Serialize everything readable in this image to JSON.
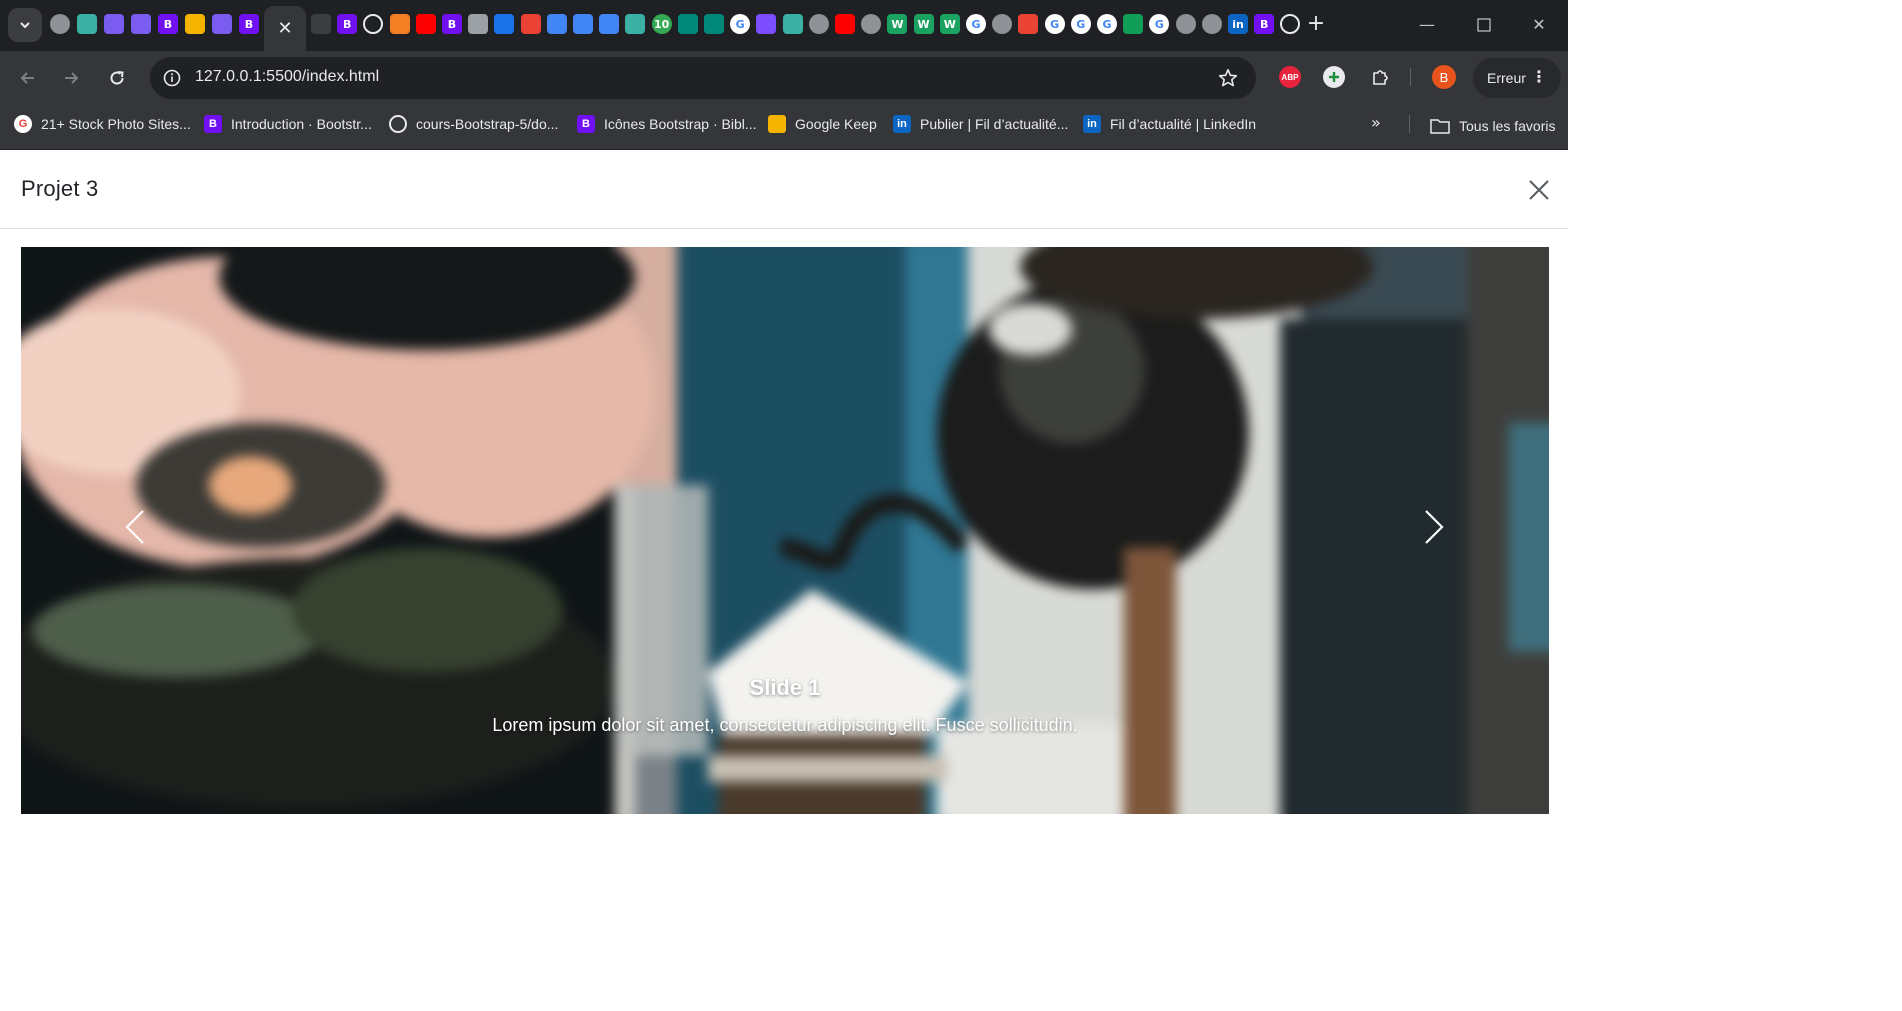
{
  "browser": {
    "address_bar": {
      "url": "127.0.0.1:5500/index.html"
    },
    "account_button": {
      "label": "Erreur"
    },
    "profile_initial": "B",
    "extensions": {
      "adblock_label": "ABP"
    },
    "tab_icons": [
      {
        "name": "tab-favicon-globe",
        "color": "#8e9196",
        "glyph": ""
      },
      {
        "name": "tab-favicon-stackblitz",
        "color": "#3bb1a5",
        "glyph": ""
      },
      {
        "name": "tab-favicon-arc",
        "color": "#7b5cf0",
        "glyph": ""
      },
      {
        "name": "tab-favicon-arc",
        "color": "#7b5cf0",
        "glyph": ""
      },
      {
        "name": "tab-favicon-bootstrap",
        "color": "#7110f2",
        "glyph": "B"
      },
      {
        "name": "tab-favicon-keep",
        "color": "#f5b400",
        "glyph": ""
      },
      {
        "name": "tab-favicon-arc",
        "color": "#7b5cf0",
        "glyph": ""
      },
      {
        "name": "tab-favicon-bootstrap",
        "color": "#7110f2",
        "glyph": "B"
      }
    ],
    "right_tab_icons": [
      {
        "name": "tab-favicon-generic",
        "color": "#3c3d41",
        "glyph": ""
      },
      {
        "name": "tab-favicon-bootstrap",
        "color": "#7110f2",
        "glyph": "B"
      },
      {
        "name": "tab-favicon-github",
        "color": "#e8eaed",
        "glyph": ""
      },
      {
        "name": "tab-favicon-stackoverflow",
        "color": "#f48024",
        "glyph": ""
      },
      {
        "name": "tab-favicon-youtube",
        "color": "#ff0000",
        "glyph": ""
      },
      {
        "name": "tab-favicon-bootstrap",
        "color": "#7110f2",
        "glyph": "B"
      },
      {
        "name": "tab-favicon-code",
        "color": "#9aa0a6",
        "glyph": ""
      },
      {
        "name": "tab-favicon-flag",
        "color": "#1a73e8",
        "glyph": ""
      },
      {
        "name": "tab-favicon-gmail",
        "color": "#ea4335",
        "glyph": ""
      },
      {
        "name": "tab-favicon-docs",
        "color": "#4285f4",
        "glyph": ""
      },
      {
        "name": "tab-favicon-docs",
        "color": "#4285f4",
        "glyph": ""
      },
      {
        "name": "tab-favicon-docs",
        "color": "#4285f4",
        "glyph": ""
      },
      {
        "name": "tab-favicon-stackblitz",
        "color": "#3bb1a5",
        "glyph": ""
      },
      {
        "name": "tab-favicon-badge",
        "color": "#34a853",
        "glyph": "10"
      },
      {
        "name": "tab-favicon-meet",
        "color": "#00897b",
        "glyph": ""
      },
      {
        "name": "tab-favicon-meet",
        "color": "#00897b",
        "glyph": ""
      },
      {
        "name": "tab-favicon-google",
        "color": "#ffffff",
        "glyph": "G"
      },
      {
        "name": "tab-favicon-hashtag",
        "color": "#7c4dff",
        "glyph": ""
      },
      {
        "name": "tab-favicon-stackblitz",
        "color": "#3bb1a5",
        "glyph": ""
      },
      {
        "name": "tab-favicon-globe",
        "color": "#8e9196",
        "glyph": ""
      },
      {
        "name": "tab-favicon-youtube",
        "color": "#ff0000",
        "glyph": ""
      },
      {
        "name": "tab-favicon-globe",
        "color": "#8e9196",
        "glyph": ""
      },
      {
        "name": "tab-favicon-w",
        "color": "#1aa260",
        "glyph": "W"
      },
      {
        "name": "tab-favicon-w",
        "color": "#1aa260",
        "glyph": "W"
      },
      {
        "name": "tab-favicon-w",
        "color": "#1aa260",
        "glyph": "W"
      },
      {
        "name": "tab-favicon-google",
        "color": "#ffffff",
        "glyph": "G"
      },
      {
        "name": "tab-favicon-globe",
        "color": "#8e9196",
        "glyph": ""
      },
      {
        "name": "tab-favicon-gmail",
        "color": "#ea4335",
        "glyph": ""
      },
      {
        "name": "tab-favicon-google",
        "color": "#ffffff",
        "glyph": "G"
      },
      {
        "name": "tab-favicon-google",
        "color": "#ffffff",
        "glyph": "G"
      },
      {
        "name": "tab-favicon-google",
        "color": "#ffffff",
        "glyph": "G"
      },
      {
        "name": "tab-favicon-classroom",
        "color": "#0f9d58",
        "glyph": ""
      },
      {
        "name": "tab-favicon-google",
        "color": "#ffffff",
        "glyph": "G"
      },
      {
        "name": "tab-favicon-globe",
        "color": "#8e9196",
        "glyph": ""
      },
      {
        "name": "tab-favicon-globe",
        "color": "#8e9196",
        "glyph": ""
      },
      {
        "name": "tab-favicon-linkedin",
        "color": "#0a66c2",
        "glyph": "in"
      },
      {
        "name": "tab-favicon-bootstrap",
        "color": "#7110f2",
        "glyph": "B"
      },
      {
        "name": "tab-favicon-github",
        "color": "#e8eaed",
        "glyph": ""
      }
    ],
    "bookmarks": [
      {
        "label": "21+ Stock Photo Sites...",
        "icon": "google-icon",
        "color": "#ffffff",
        "glyph": "G"
      },
      {
        "label": "Introduction · Bootstr...",
        "icon": "bootstrap-icon",
        "color": "#7110f2",
        "glyph": "B"
      },
      {
        "label": "cours-Bootstrap-5/do...",
        "icon": "github-icon",
        "color": "#e8eaed",
        "glyph": ""
      },
      {
        "label": "Icônes Bootstrap · Bibl...",
        "icon": "bootstrap-icon",
        "color": "#7110f2",
        "glyph": "B"
      },
      {
        "label": "Google Keep",
        "icon": "keep-icon",
        "color": "#f5b400",
        "glyph": ""
      },
      {
        "label": "Publier | Fil d’actualité...",
        "icon": "linkedin-icon",
        "color": "#0a66c2",
        "glyph": "in"
      },
      {
        "label": "Fil d’actualité | LinkedIn",
        "icon": "linkedin-icon",
        "color": "#0a66c2",
        "glyph": "in"
      }
    ],
    "all_bookmarks_label": "Tous les favoris"
  },
  "page": {
    "modal": {
      "title": "Projet 3",
      "carousel": {
        "slide_title": "Slide 1",
        "slide_text": "Lorem ipsum dolor sit amet, consectetur adipiscing elit. Fusce sollicitudin."
      }
    }
  }
}
